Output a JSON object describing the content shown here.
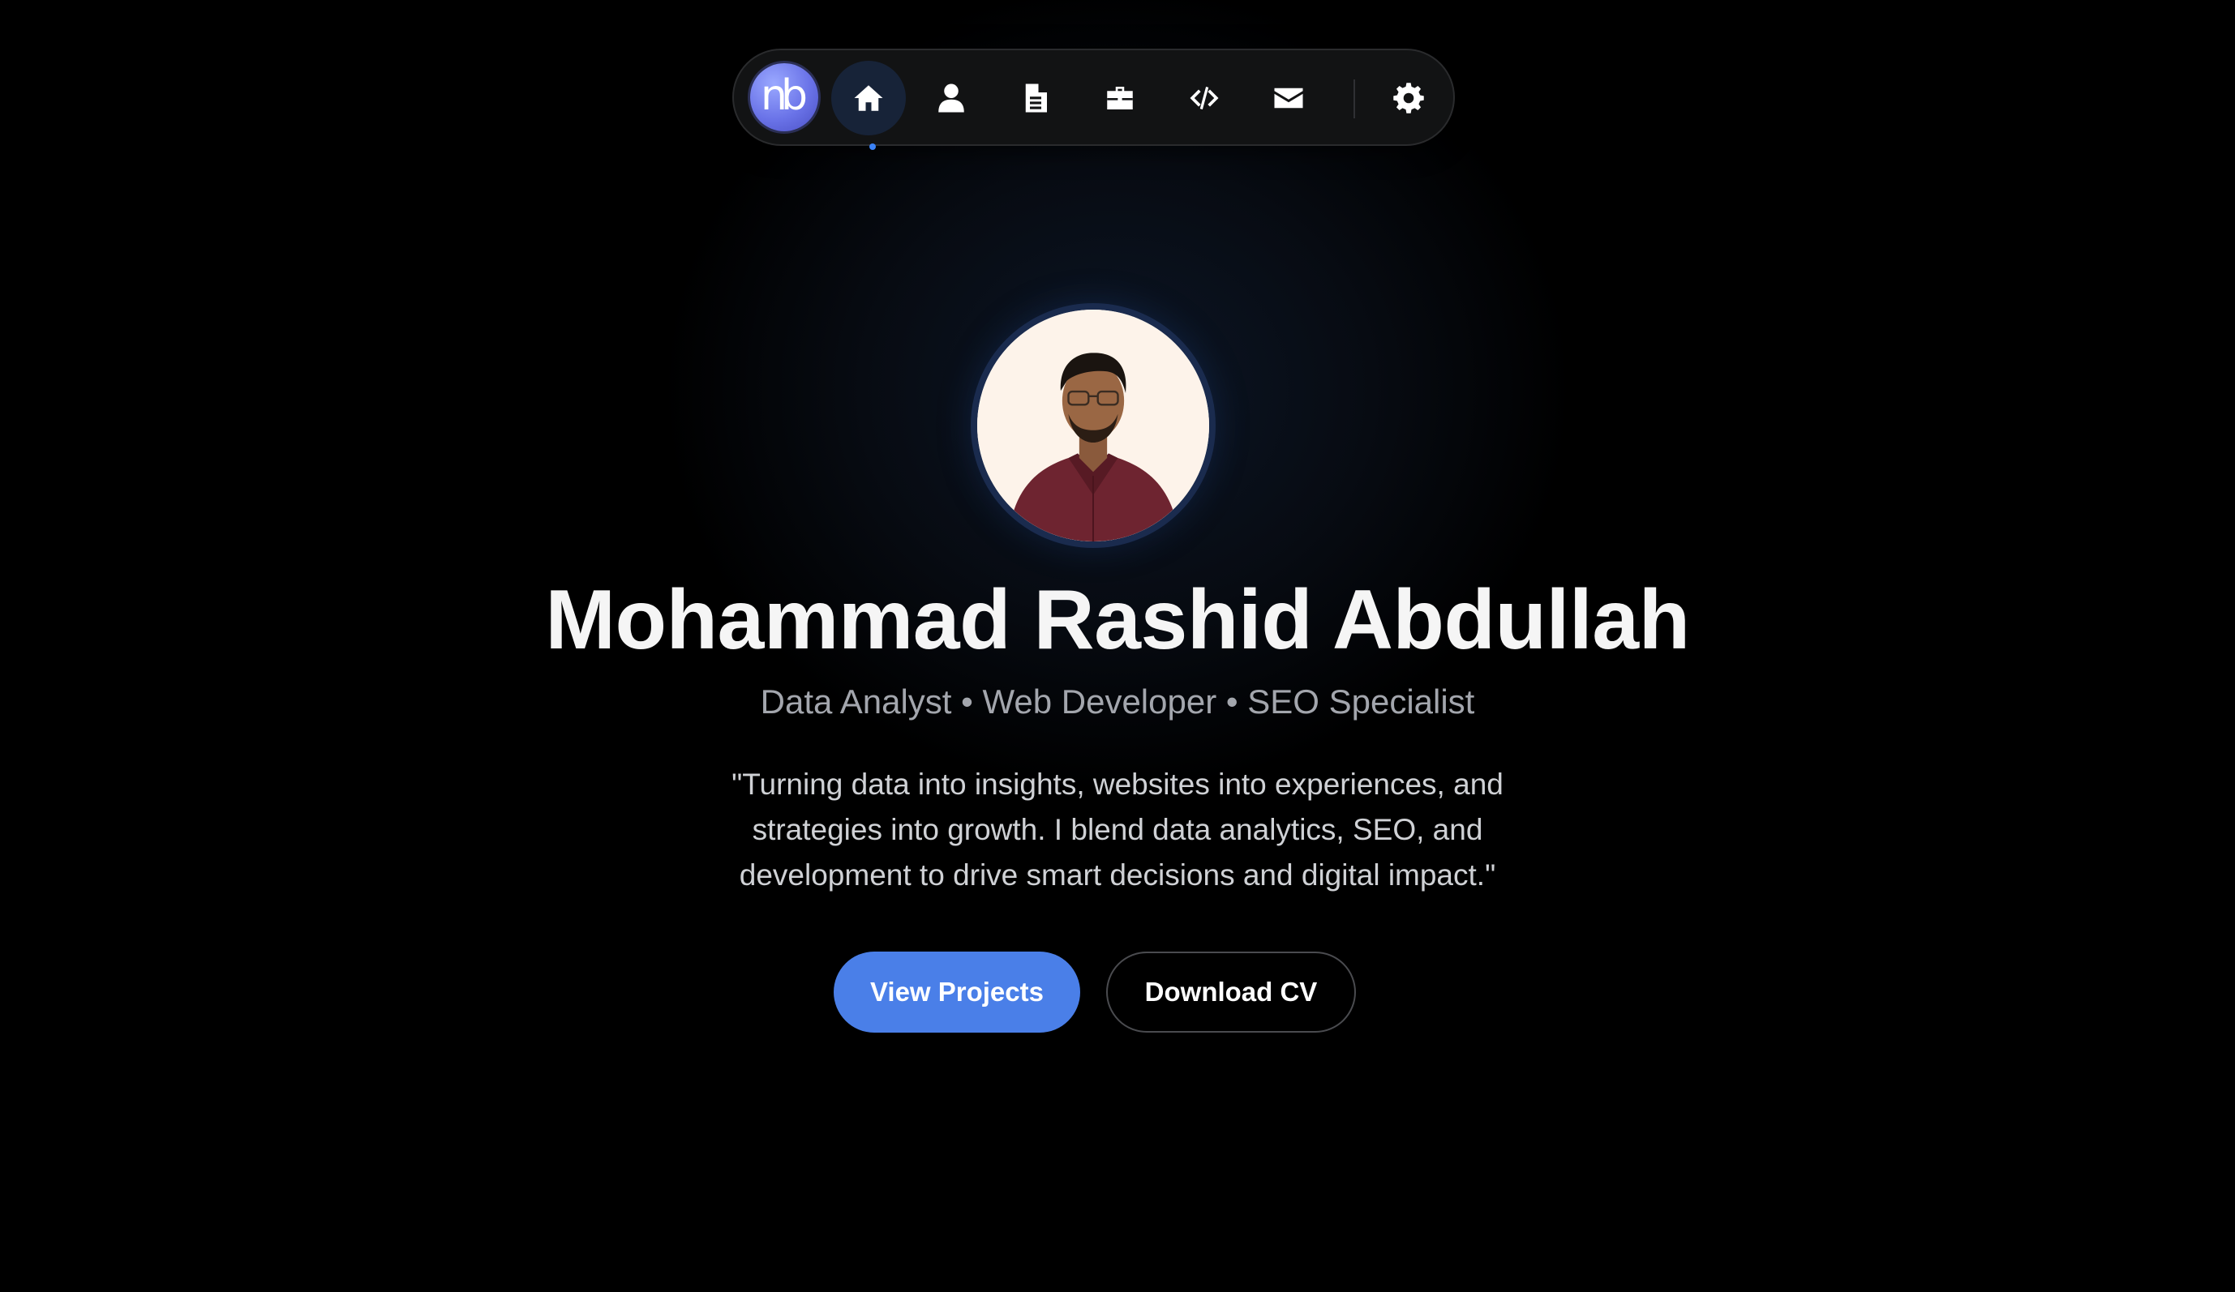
{
  "nav": {
    "logo_text": "nb",
    "items": [
      {
        "icon": "home-icon",
        "active": true
      },
      {
        "icon": "user-icon",
        "active": false
      },
      {
        "icon": "document-icon",
        "active": false
      },
      {
        "icon": "briefcase-icon",
        "active": false
      },
      {
        "icon": "code-icon",
        "active": false
      },
      {
        "icon": "envelope-icon",
        "active": false
      },
      {
        "icon": "gear-icon",
        "active": false
      }
    ],
    "active_color": "#3b82f6"
  },
  "hero": {
    "name": "Mohammad Rashid Abdullah",
    "tagline": "Data Analyst • Web Developer • SEO Specialist",
    "quote": "\"Turning data into insights, websites into experiences, and strategies into growth. I blend data analytics, SEO, and development to drive smart decisions and digital impact.\"",
    "primary_button": "View Projects",
    "secondary_button": "Download CV"
  },
  "colors": {
    "accent": "#4a7fe8",
    "background": "#000000"
  }
}
